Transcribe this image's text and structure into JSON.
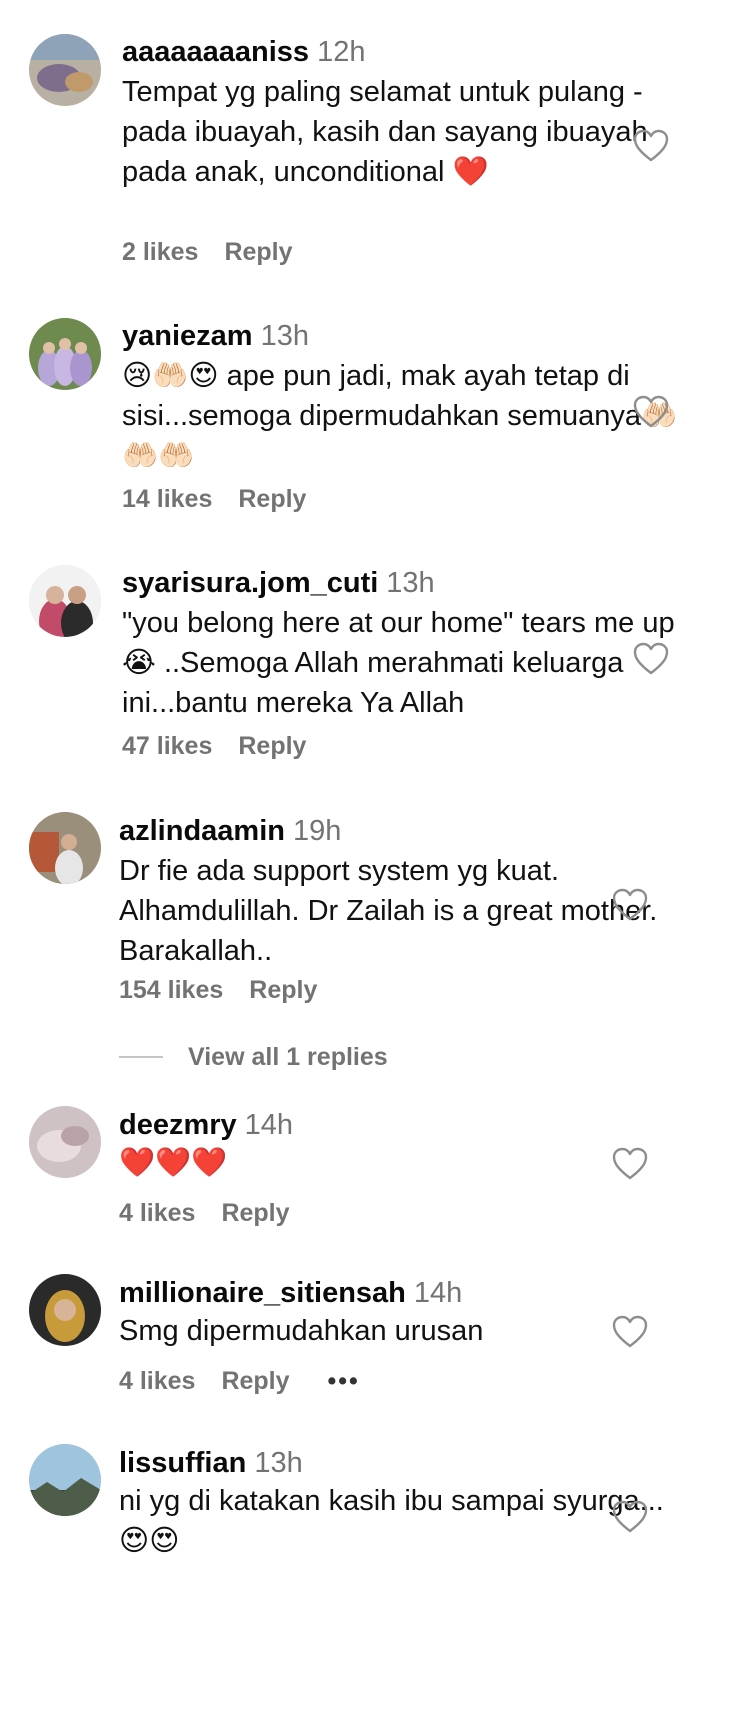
{
  "comments": [
    {
      "username": "aaaaaaaaniss",
      "time": "12h",
      "text": "Tempat yg paling selamat untuk pulang - pada ibuayah, kasih dan sayang ibuayah pada anak, unconditional ❤️",
      "likes": "2 likes",
      "reply": "Reply"
    },
    {
      "username": "yaniezam",
      "time": "13h",
      "text": "😢🤲🏻😍 ape pun jadi, mak ayah tetap di sisi...semoga dipermudahkan semuanya🤲🏻🤲🏻🤲🏻",
      "likes": "14 likes",
      "reply": "Reply"
    },
    {
      "username": "syarisura.jom_cuti",
      "time": "13h",
      "text": "\"you belong here at our home\" tears me up 😭 ..Semoga Allah merahmati keluarga ini...bantu mereka Ya Allah",
      "likes": "47 likes",
      "reply": "Reply"
    },
    {
      "username": "azlindaamin",
      "time": "19h",
      "text": "Dr fie ada support system yg kuat. Alhamdulillah. Dr Zailah is a great mother. Barakallah..",
      "likes": "154 likes",
      "reply": "Reply",
      "view_replies": "View all 1 replies"
    },
    {
      "username": "deezmry",
      "time": "14h",
      "text": "❤️❤️❤️",
      "likes": "4 likes",
      "reply": "Reply"
    },
    {
      "username": "millionaire_sitiensah",
      "time": "14h",
      "text": "Smg dipermudahkan urusan",
      "likes": "4 likes",
      "reply": "Reply",
      "more": "•••"
    },
    {
      "username": "lissuffian",
      "time": "13h",
      "text": "ni yg di katakan kasih ibu sampai syurga...😍😍"
    }
  ],
  "icons": {
    "like": "heart-outline-icon",
    "more": "more-dots-icon"
  },
  "colors": {
    "secondary_text": "#737373",
    "primary_text": "#111111"
  }
}
